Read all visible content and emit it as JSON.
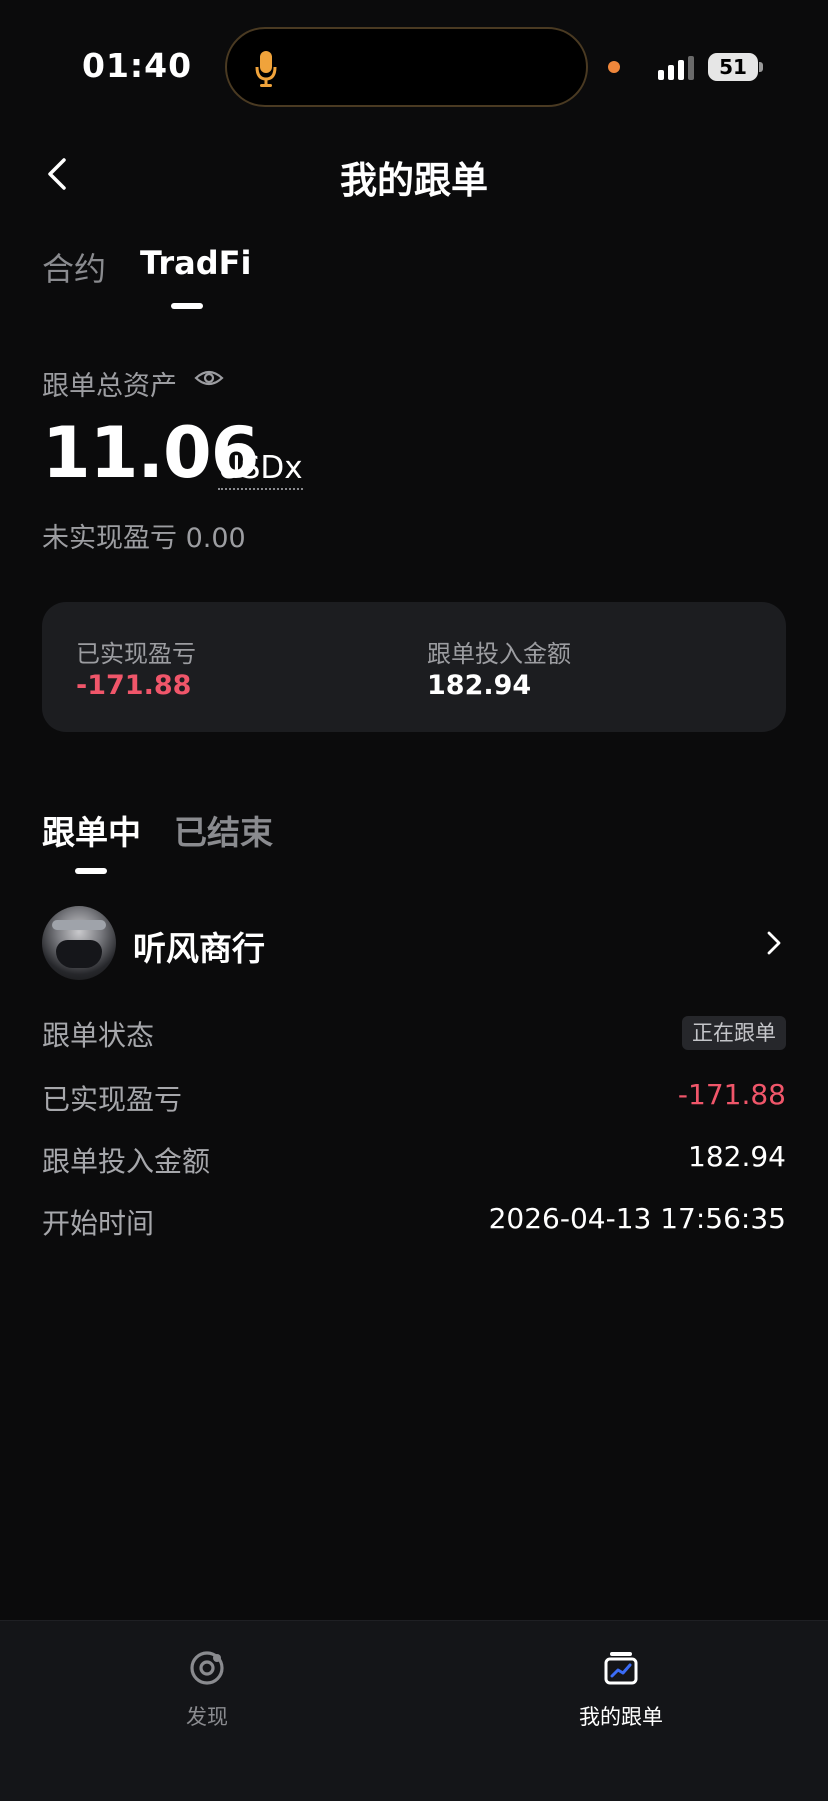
{
  "status_bar": {
    "time": "01:40",
    "battery": "51"
  },
  "header": {
    "title": "我的跟单"
  },
  "top_tabs": [
    {
      "label": "合约",
      "active": false
    },
    {
      "label": "TradFi",
      "active": true
    }
  ],
  "assets": {
    "label": "跟单总资产",
    "value": "11.06",
    "unit": "USDx",
    "unrealized": "未实现盈亏 0.00"
  },
  "summary_card": {
    "realized_label": "已实现盈亏",
    "realized_value": "-171.88",
    "invested_label": "跟单投入金额",
    "invested_value": "182.94"
  },
  "follow_tabs": [
    {
      "label": "跟单中",
      "active": true
    },
    {
      "label": "已结束",
      "active": false
    }
  ],
  "trader": {
    "name": "听风商行",
    "details": [
      {
        "label": "跟单状态",
        "value": "正在跟单",
        "type": "badge"
      },
      {
        "label": "已实现盈亏",
        "value": "-171.88",
        "type": "negative"
      },
      {
        "label": "跟单投入金额",
        "value": "182.94",
        "type": "plain"
      },
      {
        "label": "开始时间",
        "value": "2026-04-13 17:56:35",
        "type": "plain"
      }
    ]
  },
  "bottom_nav": [
    {
      "label": "发现",
      "icon": "discover-icon",
      "active": false
    },
    {
      "label": "我的跟单",
      "icon": "my-copy-trading-icon",
      "active": true
    }
  ],
  "colors": {
    "background": "#0b0b0c",
    "card": "#1c1d20",
    "negative": "#f0566a",
    "muted": "#9c9da1",
    "accent_blue": "#3b6cf6",
    "recording_orange": "#f0873b"
  }
}
